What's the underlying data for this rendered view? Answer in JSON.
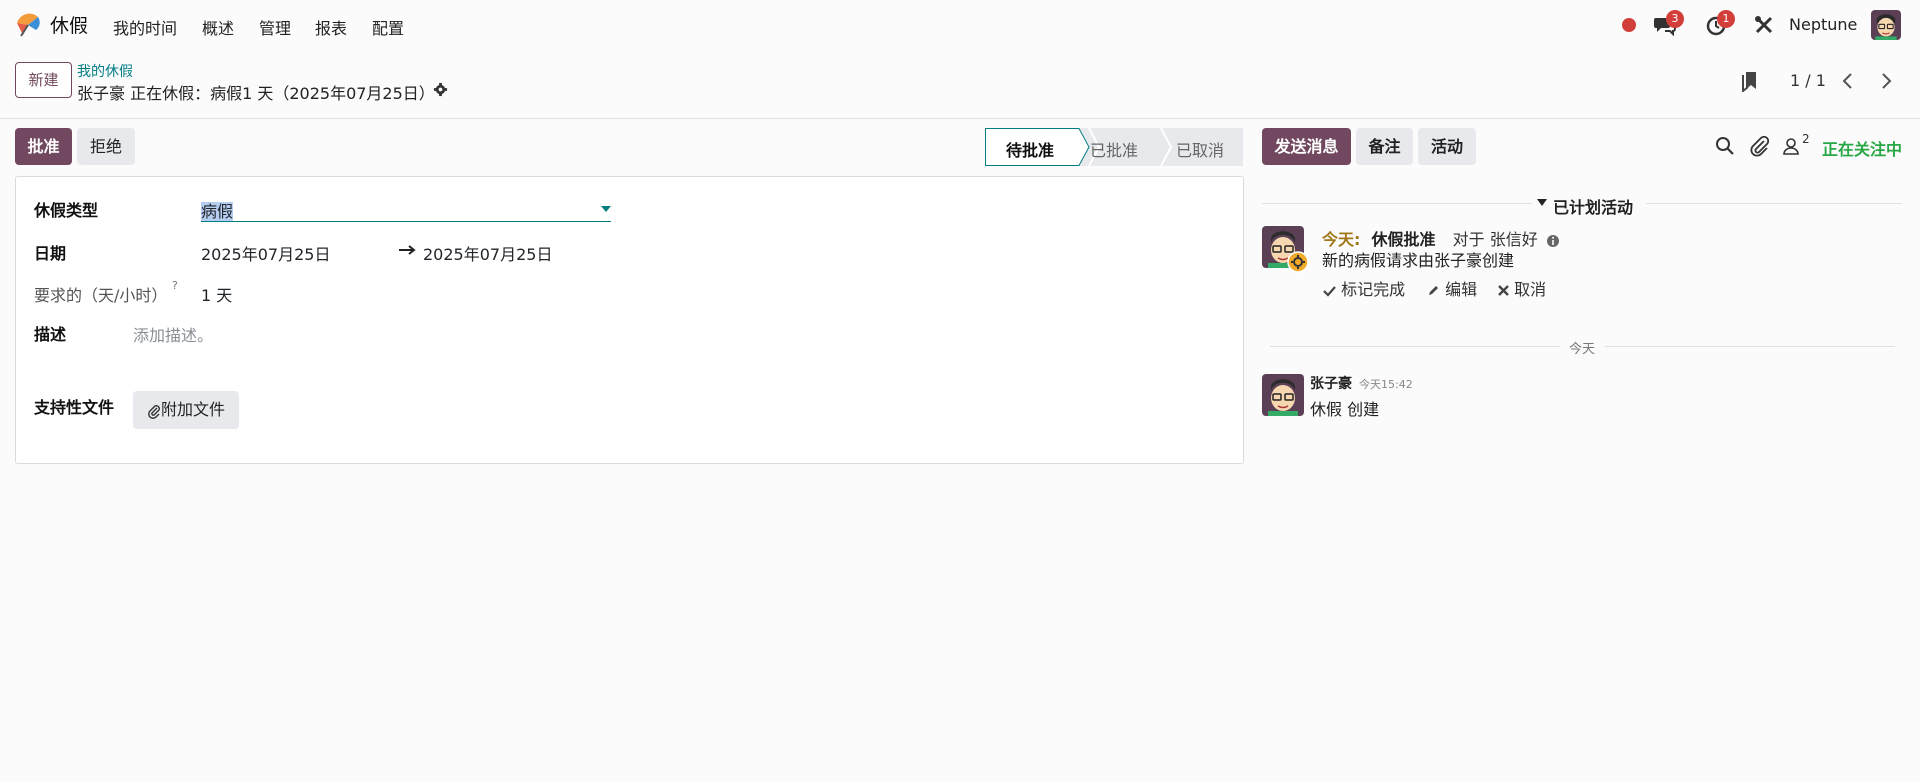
{
  "navbar": {
    "app_name": "休假",
    "menu": [
      "我的时间",
      "概述",
      "管理",
      "报表",
      "配置"
    ],
    "messages_count": "3",
    "activities_count": "1",
    "company": "Neptune"
  },
  "control": {
    "new_label": "新建",
    "breadcrumb": "我的休假",
    "record_title": "张子豪 正在休假：病假1 天（2025年07月25日）",
    "pager": "1 / 1"
  },
  "actions": {
    "approve": "批准",
    "refuse": "拒绝"
  },
  "status": {
    "stages": [
      "待批准",
      "已批准",
      "已取消"
    ],
    "current": "待批准"
  },
  "form": {
    "leave_type_label": "休假类型",
    "leave_type_value": "病假",
    "dates_label": "日期",
    "date_from": "2025年07月25日",
    "date_to": "2025年07月25日",
    "duration_label": "要求的（天/小时）",
    "duration_help": "?",
    "duration_value": "1 天",
    "description_label": "描述",
    "description_placeholder": "添加描述。",
    "supporting_label": "支持性文件",
    "attach_label": "附加文件"
  },
  "chatter": {
    "send_message": "发送消息",
    "log_note": "备注",
    "activities": "活动",
    "followers_count": "2",
    "following": "正在关注中",
    "planned_title": "已计划活动",
    "activity": {
      "due": "今天:",
      "type": "休假批准",
      "for_text": "对于 张信好",
      "summary": "新的病假请求由张子豪创建",
      "mark_done": "标记完成",
      "edit": "编辑",
      "cancel": "取消"
    },
    "date_separator": "今天",
    "message": {
      "author": "张子豪",
      "time": "今天15:42",
      "body": "休假 创建"
    }
  },
  "colors": {
    "brand": "#71485f",
    "teal": "#017e84",
    "badge": "#d23f3a",
    "following": "#28a745"
  }
}
